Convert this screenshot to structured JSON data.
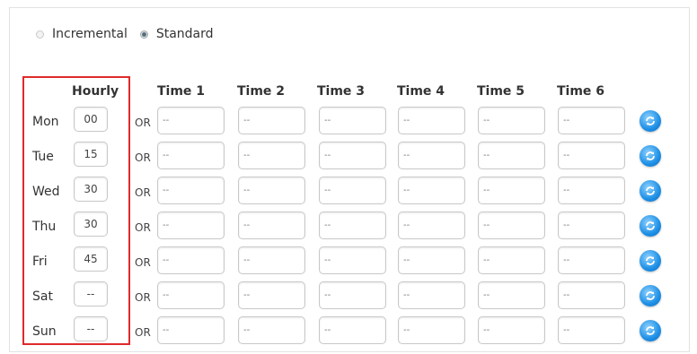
{
  "mode": {
    "incremental_label": "Incremental",
    "standard_label": "Standard",
    "selected": "Standard"
  },
  "columns": {
    "hourly": "Hourly",
    "times": [
      "Time 1",
      "Time 2",
      "Time 3",
      "Time 4",
      "Time 5",
      "Time 6"
    ]
  },
  "or_label": "OR",
  "rows": [
    {
      "day": "Mon",
      "hourly": "00",
      "times": [
        "--",
        "--",
        "--",
        "--",
        "--",
        "--"
      ]
    },
    {
      "day": "Tue",
      "hourly": "15",
      "times": [
        "--",
        "--",
        "--",
        "--",
        "--",
        "--"
      ]
    },
    {
      "day": "Wed",
      "hourly": "30",
      "times": [
        "--",
        "--",
        "--",
        "--",
        "--",
        "--"
      ]
    },
    {
      "day": "Thu",
      "hourly": "30",
      "times": [
        "--",
        "--",
        "--",
        "--",
        "--",
        "--"
      ]
    },
    {
      "day": "Fri",
      "hourly": "45",
      "times": [
        "--",
        "--",
        "--",
        "--",
        "--",
        "--"
      ]
    },
    {
      "day": "Sat",
      "hourly": "--",
      "times": [
        "--",
        "--",
        "--",
        "--",
        "--",
        "--"
      ]
    },
    {
      "day": "Sun",
      "hourly": "--",
      "times": [
        "--",
        "--",
        "--",
        "--",
        "--",
        "--"
      ]
    }
  ],
  "copy_icon": "refresh-copy-icon",
  "highlight_color": "#e02a2a",
  "icon_color": "#1d8fe6"
}
